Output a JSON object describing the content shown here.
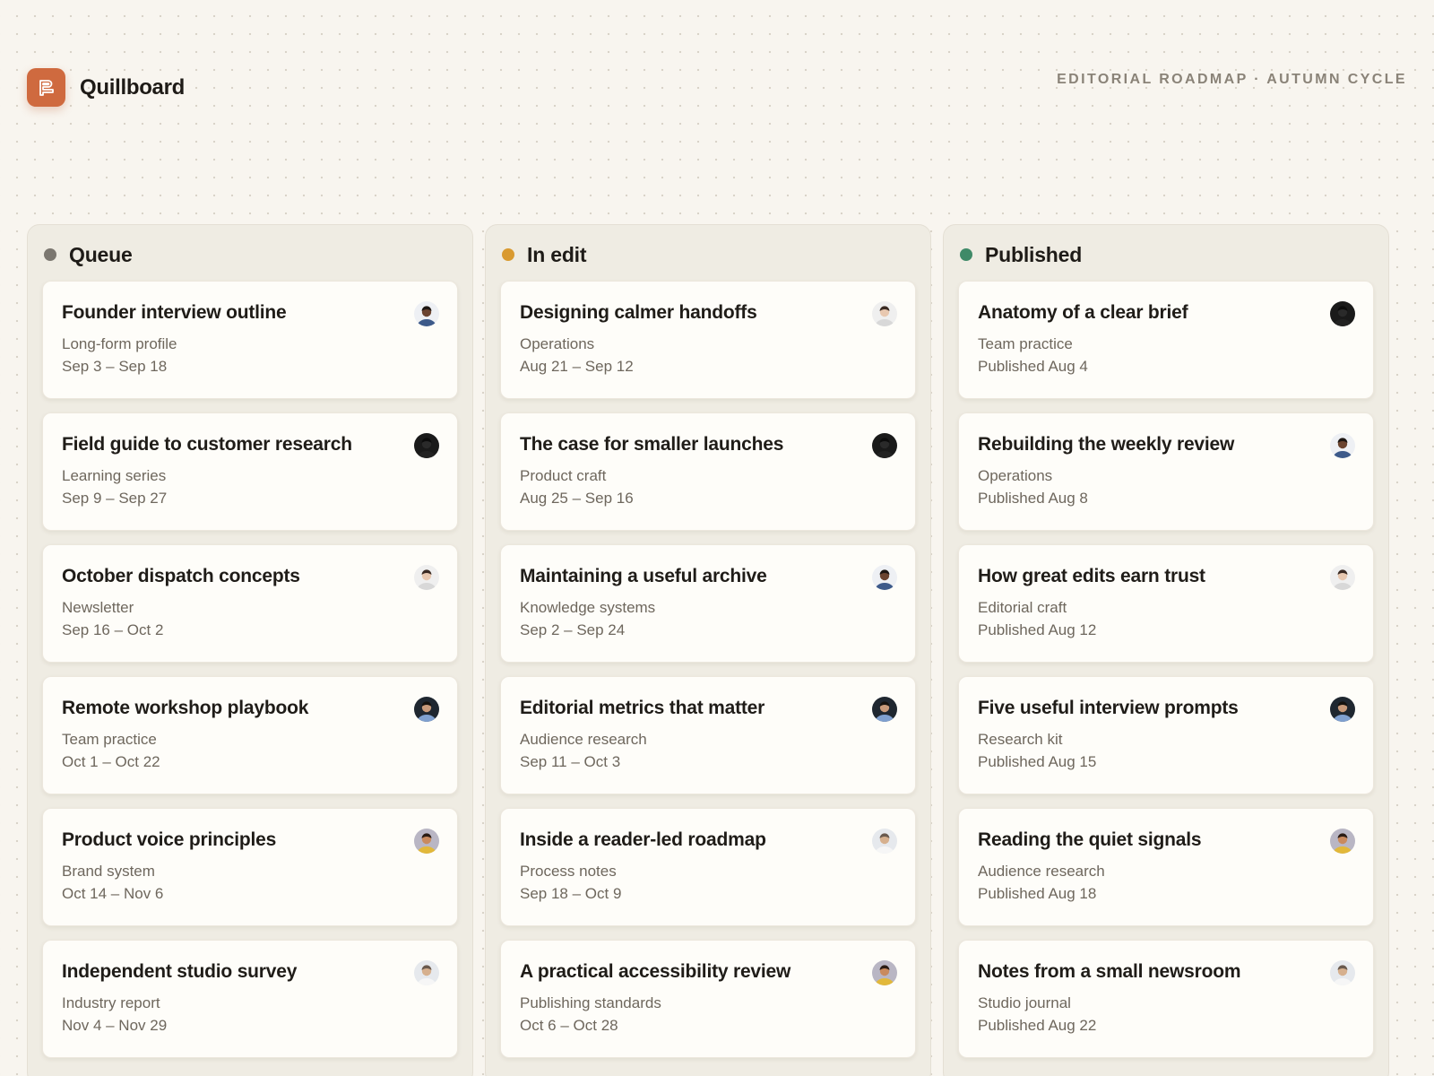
{
  "app": {
    "name": "Quillboard",
    "subtitle": "EDITORIAL ROADMAP · AUTUMN CYCLE",
    "accent": "#cf6a3f"
  },
  "columns": [
    {
      "title": "Queue",
      "dot_color": "#7b7770",
      "cards": [
        {
          "title": "Founder interview outline",
          "category": "Long-form profile",
          "date": "Sep 3 – Sep 18",
          "avatar": "avatar-man-dark"
        },
        {
          "title": "Field guide to customer research",
          "category": "Learning series",
          "date": "Sep 9 – Sep 27",
          "avatar": "avatar-silhouette"
        },
        {
          "title": "October dispatch concepts",
          "category": "Newsletter",
          "date": "Sep 16 – Oct 2",
          "avatar": "avatar-woman-light"
        },
        {
          "title": "Remote workshop playbook",
          "category": "Team practice",
          "date": "Oct 1 – Oct 22",
          "avatar": "avatar-person-blue"
        },
        {
          "title": "Product voice principles",
          "category": "Brand system",
          "date": "Oct 14 – Nov 6",
          "avatar": "avatar-woman-yellow"
        },
        {
          "title": "Independent studio survey",
          "category": "Industry report",
          "date": "Nov 4 – Nov 29",
          "avatar": "avatar-man-white"
        }
      ]
    },
    {
      "title": "In edit",
      "dot_color": "#d99a30",
      "cards": [
        {
          "title": "Designing calmer handoffs",
          "category": "Operations",
          "date": "Aug 21 – Sep 12",
          "avatar": "avatar-woman-light"
        },
        {
          "title": "The case for smaller launches",
          "category": "Product craft",
          "date": "Aug 25 – Sep 16",
          "avatar": "avatar-silhouette"
        },
        {
          "title": "Maintaining a useful archive",
          "category": "Knowledge systems",
          "date": "Sep 2 – Sep 24",
          "avatar": "avatar-man-dark"
        },
        {
          "title": "Editorial metrics that matter",
          "category": "Audience research",
          "date": "Sep 11 – Oct 3",
          "avatar": "avatar-person-blue"
        },
        {
          "title": "Inside a reader-led roadmap",
          "category": "Process notes",
          "date": "Sep 18 – Oct 9",
          "avatar": "avatar-man-white"
        },
        {
          "title": "A practical accessibility review",
          "category": "Publishing standards",
          "date": "Oct 6 – Oct 28",
          "avatar": "avatar-woman-yellow"
        }
      ]
    },
    {
      "title": "Published",
      "dot_color": "#3f8a68",
      "cards": [
        {
          "title": "Anatomy of a clear brief",
          "category": "Team practice",
          "date": "Published Aug 4",
          "avatar": "avatar-silhouette"
        },
        {
          "title": "Rebuilding the weekly review",
          "category": "Operations",
          "date": "Published Aug 8",
          "avatar": "avatar-man-dark"
        },
        {
          "title": "How great edits earn trust",
          "category": "Editorial craft",
          "date": "Published Aug 12",
          "avatar": "avatar-woman-light"
        },
        {
          "title": "Five useful interview prompts",
          "category": "Research kit",
          "date": "Published Aug 15",
          "avatar": "avatar-person-blue"
        },
        {
          "title": "Reading the quiet signals",
          "category": "Audience research",
          "date": "Published Aug 18",
          "avatar": "avatar-woman-yellow"
        },
        {
          "title": "Notes from a small newsroom",
          "category": "Studio journal",
          "date": "Published Aug 22",
          "avatar": "avatar-man-white"
        }
      ]
    }
  ]
}
